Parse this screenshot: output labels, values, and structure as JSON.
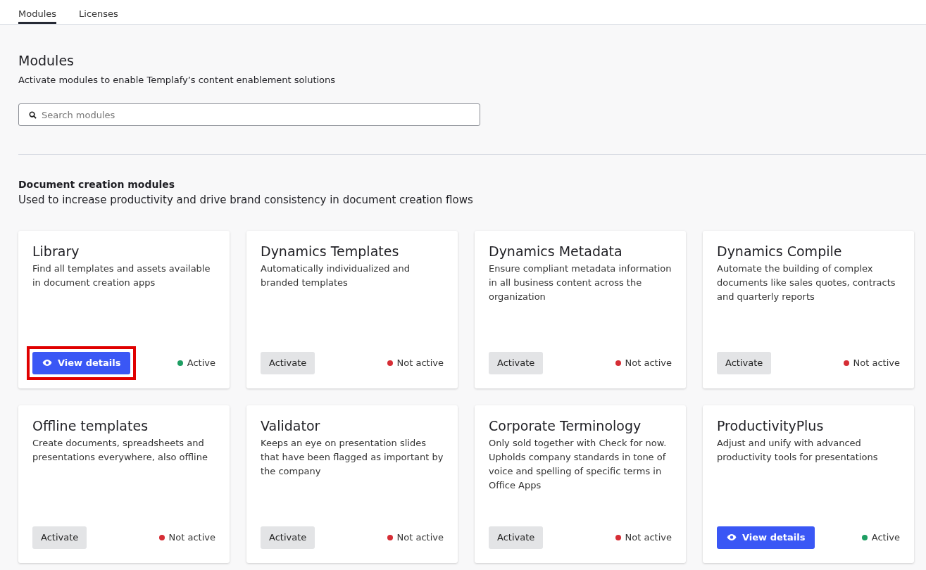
{
  "tabs": [
    {
      "label": "Modules",
      "selected": true
    },
    {
      "label": "Licenses",
      "selected": false
    }
  ],
  "header": {
    "title": "Modules",
    "subtitle": "Activate modules to enable Templafy’s content enablement solutions"
  },
  "search": {
    "placeholder": "Search modules"
  },
  "section": {
    "title": "Document creation modules",
    "description": "Used to increase productivity and drive brand consistency in document creation flows"
  },
  "modules": [
    {
      "name": "Library",
      "description": "Find all templates and assets available in document creation apps",
      "action": {
        "kind": "view",
        "label": "View details"
      },
      "active": true,
      "status": "Active",
      "highlighted": true
    },
    {
      "name": "Dynamics Templates",
      "description": "Automatically individualized and branded templates",
      "action": {
        "kind": "activate",
        "label": "Activate"
      },
      "active": false,
      "status": "Not active",
      "highlighted": false
    },
    {
      "name": "Dynamics Metadata",
      "description": "Ensure compliant metadata information in all business content across the organization",
      "action": {
        "kind": "activate",
        "label": "Activate"
      },
      "active": false,
      "status": "Not active",
      "highlighted": false
    },
    {
      "name": "Dynamics Compile",
      "description": "Automate the building of complex documents like sales quotes, contracts and quarterly reports",
      "action": {
        "kind": "activate",
        "label": "Activate"
      },
      "active": false,
      "status": "Not active",
      "highlighted": false
    },
    {
      "name": "Offline templates",
      "description": "Create documents, spreadsheets and presentations everywhere, also offline",
      "action": {
        "kind": "activate",
        "label": "Activate"
      },
      "active": false,
      "status": "Not active",
      "highlighted": false
    },
    {
      "name": "Validator",
      "description": "Keeps an eye on presentation slides that have been flagged as important by the company",
      "action": {
        "kind": "activate",
        "label": "Activate"
      },
      "active": false,
      "status": "Not active",
      "highlighted": false
    },
    {
      "name": "Corporate Terminology",
      "description": "Only sold together with Check for now. Upholds company standards in tone of voice and spelling of specific terms in Office Apps",
      "action": {
        "kind": "activate",
        "label": "Activate"
      },
      "active": false,
      "status": "Not active",
      "highlighted": false
    },
    {
      "name": "ProductivityPlus",
      "description": "Adjust and unify with advanced productivity tools for presentations",
      "action": {
        "kind": "view",
        "label": "View details"
      },
      "active": true,
      "status": "Active",
      "highlighted": false
    }
  ]
}
